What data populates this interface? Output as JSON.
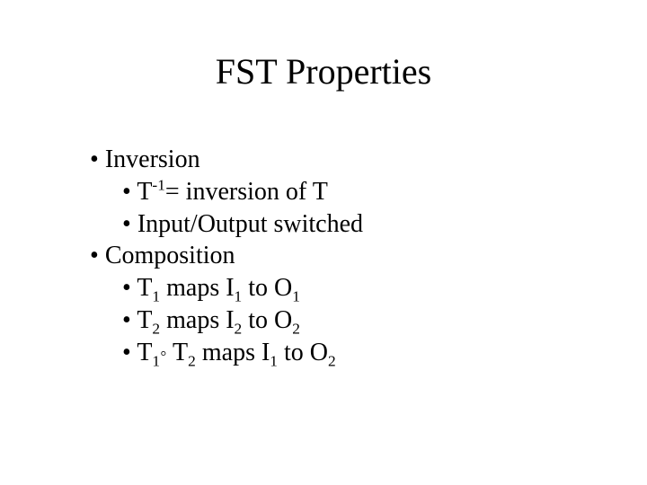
{
  "title": "FST Properties",
  "bullets": {
    "inversion": {
      "label": "Inversion",
      "sub": {
        "tinv_prefix": "T",
        "tinv_exp": "-1",
        "tinv_suffix": "= inversion of T",
        "io_switched": "Input/Output switched"
      }
    },
    "composition": {
      "label": "Composition",
      "sub": {
        "t1_maps": {
          "p1": "T",
          "s1": "1",
          "p2": " maps I",
          "s2": "1",
          "p3": " to O",
          "s3": "1"
        },
        "t2_maps": {
          "p1": "T",
          "s1": "2",
          "p2": " maps I",
          "s2": "2",
          "p3": " to O",
          "s3": "2"
        },
        "t1t2_maps": {
          "p1": "T",
          "s1": "1",
          "op": "◦",
          "p2": " T",
          "s2": "2",
          "p3": " maps I",
          "s3": "1",
          "p4": " to O",
          "s4": "2"
        }
      }
    }
  },
  "bullet_char": "•"
}
